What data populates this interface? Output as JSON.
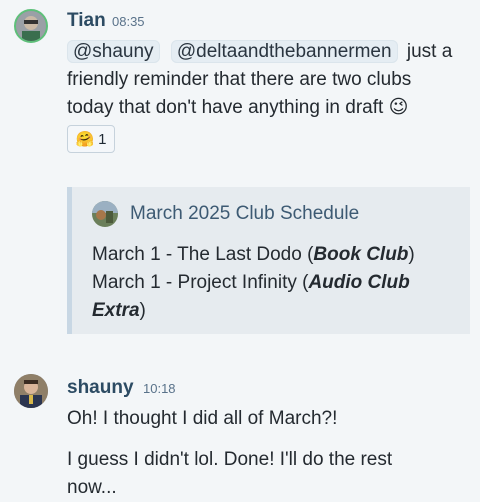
{
  "message1": {
    "author": "Tian",
    "time": "08:35",
    "mentions": [
      "@shauny",
      "@deltaandthebannermen"
    ],
    "text_after_mentions": "just a",
    "line2": "friendly reminder that there are two clubs",
    "line3": "today that don't have anything in draft",
    "emoji": "😉",
    "reaction": {
      "emoji": "🤗",
      "count": "1"
    }
  },
  "quote": {
    "title": "March 2025 Club Schedule",
    "line1_prefix": "March 1 - The Last Dodo (",
    "line1_bold": "Book Club",
    "line1_suffix": ")",
    "line2_prefix": "March 1 - Project Infinity (",
    "line2_bold": "Audio Club",
    "line3_bold": "Extra",
    "line3_suffix": ")"
  },
  "message2": {
    "author": "shauny",
    "time": "10:18",
    "para1": "Oh! I thought I did all of March?!",
    "para2_line1": "I guess I didn't lol. Done! I'll do the rest",
    "para2_line2": "now..."
  },
  "colors": {
    "background": "#f3f6f8",
    "author": "#2c4b63",
    "quote_bg": "#e6ebef",
    "quote_border": "#c8d7e4",
    "avatar_ring": "#5ec07a"
  }
}
